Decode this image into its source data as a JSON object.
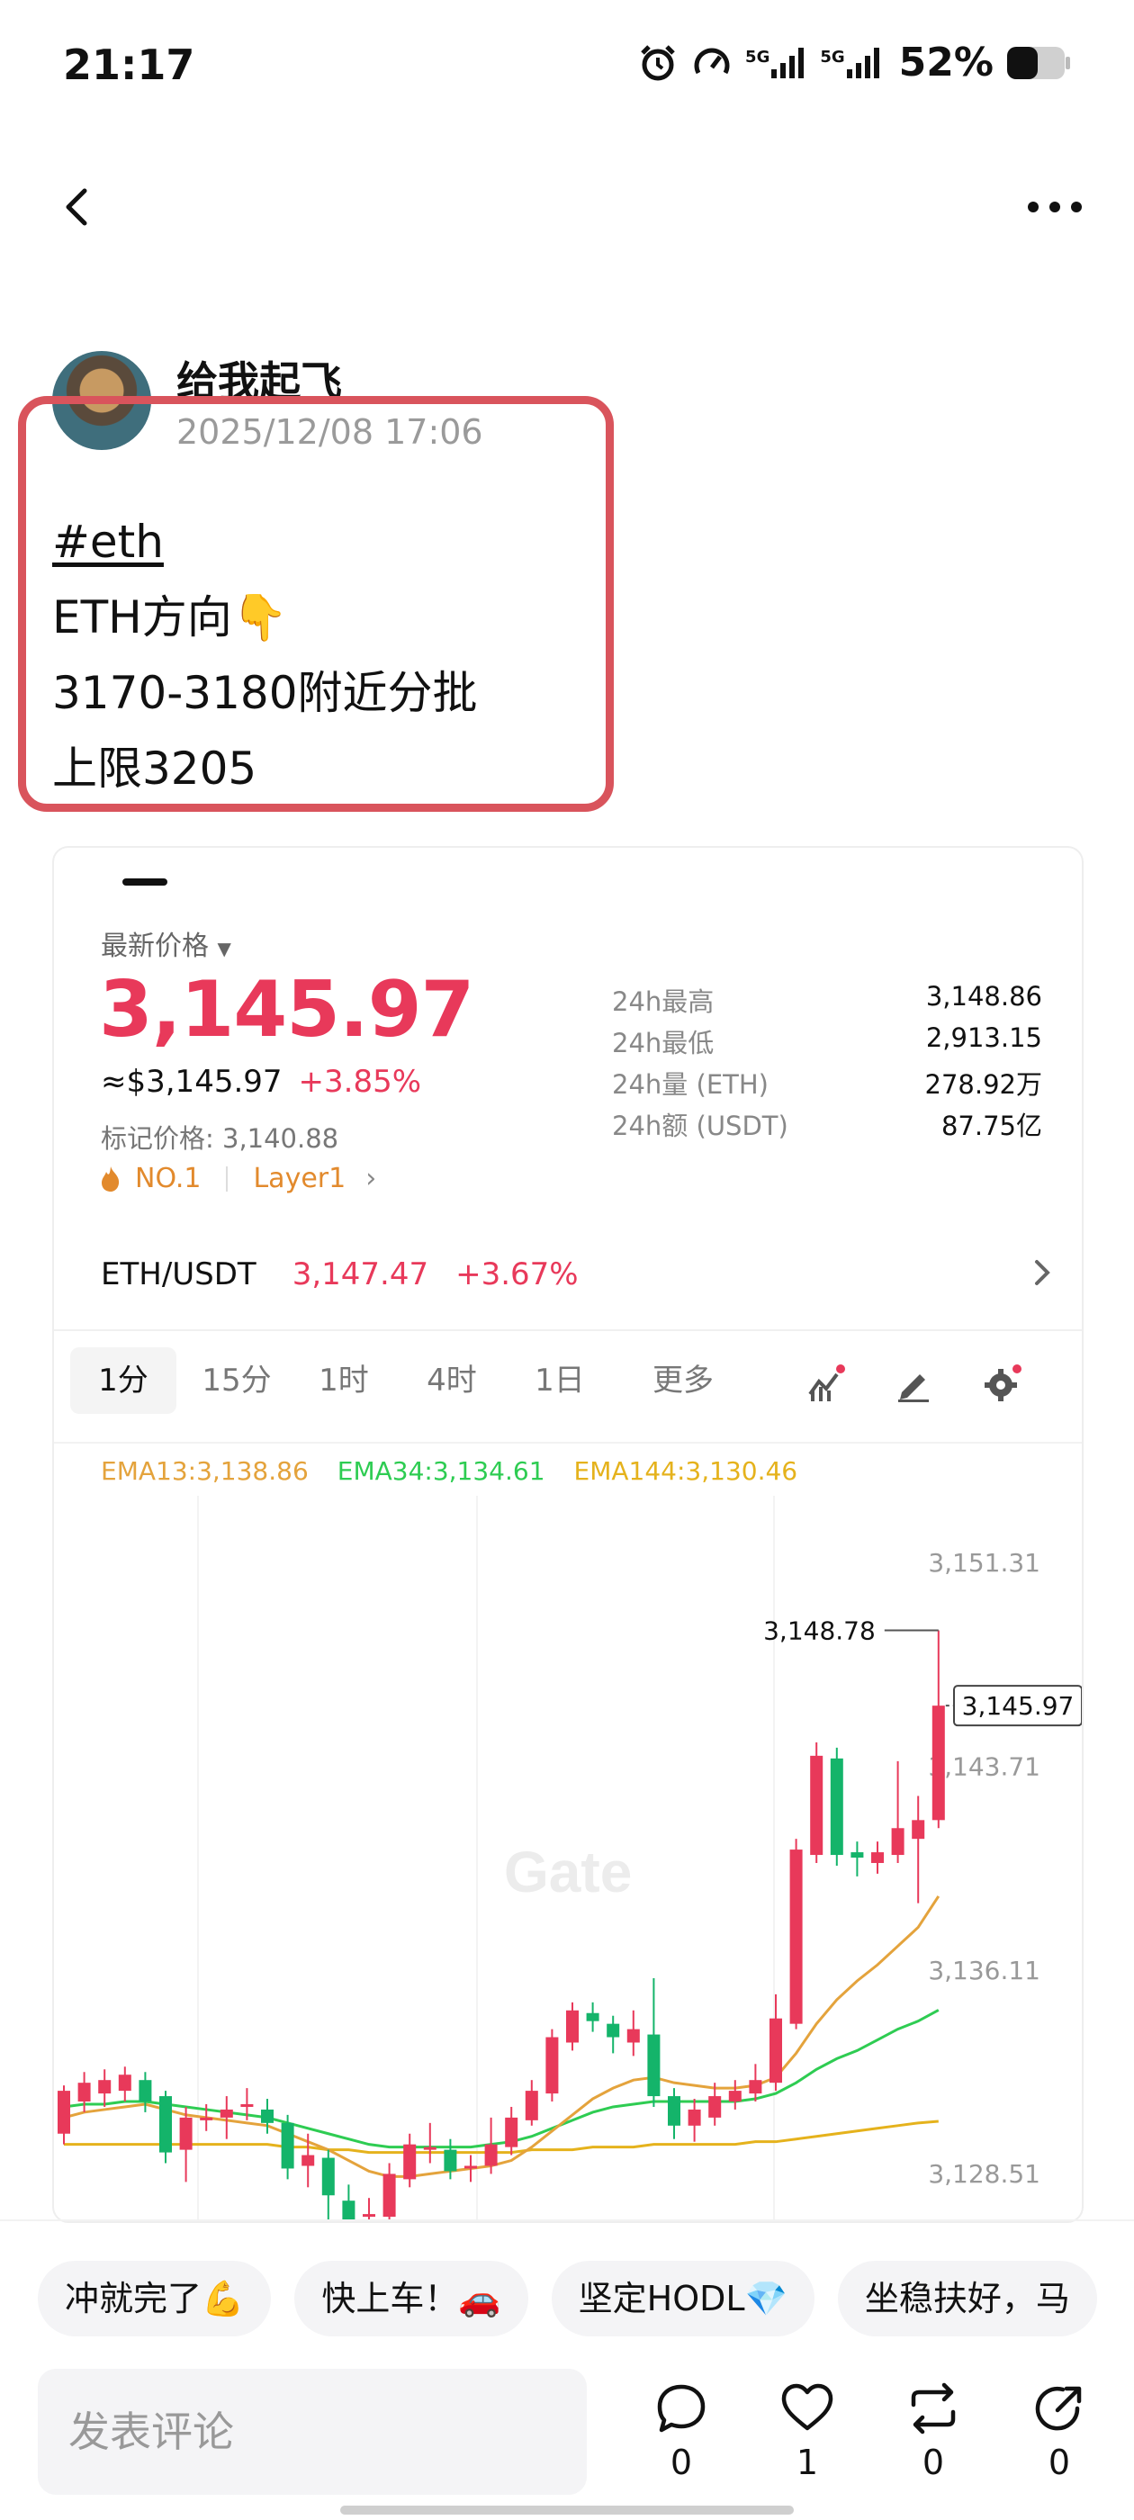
{
  "status_bar": {
    "time": "21:17",
    "network1": "5G",
    "network2": "5G",
    "battery": "52%"
  },
  "post": {
    "author": "给我起飞",
    "time": "2025/12/08 17:06",
    "lines": {
      "hashtag": "#eth",
      "l2": "ETH方向👇",
      "l3": "3170-3180附近分批",
      "l4": "上限3205"
    }
  },
  "ticker": {
    "latest_label": "最新价格",
    "price": "3,145.97",
    "usd_equiv": "≈$3,145.97",
    "change": "+3.85%",
    "mark_price": "标记价格: 3,140.88",
    "rank": "NO.1",
    "category": "Layer1",
    "stats": [
      {
        "label": "24h最高",
        "value": "3,148.86"
      },
      {
        "label": "24h最低",
        "value": "2,913.15"
      },
      {
        "label": "24h量 (ETH)",
        "value": "278.92万"
      },
      {
        "label": "24h额 (USDT)",
        "value": "87.75亿"
      }
    ],
    "pair": {
      "name": "ETH/USDT",
      "price": "3,147.47",
      "change": "+3.67%"
    },
    "intervals": [
      "1分",
      "15分",
      "1时",
      "4时",
      "1日",
      "更多"
    ],
    "active_interval": "1分",
    "ema": {
      "ema13": "EMA13:3,138.86",
      "ema34": "EMA34:3,134.61",
      "ema144": "EMA144:3,130.46"
    }
  },
  "chart_data": {
    "type": "candlestick",
    "title": "",
    "watermark": "Gate",
    "y_ticks": [
      "3,151.31",
      "3,143.71",
      "3,136.11",
      "3,128.51"
    ],
    "ylim": [
      3126.6,
      3153.8
    ],
    "high_label": "3,148.78",
    "high_value": 3148.78,
    "last_label": "3,145.97",
    "last_value": 3145.97,
    "colors": {
      "up": "#e8395a",
      "down": "#14b46a",
      "ema13": "#e4a33c",
      "ema34": "#2ecc52",
      "ema144": "#e5b21c"
    },
    "candles": [
      {
        "o": 3130.0,
        "c": 3131.6,
        "h": 3131.8,
        "l": 3129.6
      },
      {
        "o": 3131.2,
        "c": 3131.9,
        "h": 3132.3,
        "l": 3130.8
      },
      {
        "o": 3131.5,
        "c": 3132.0,
        "h": 3132.4,
        "l": 3131.0
      },
      {
        "o": 3131.6,
        "c": 3132.2,
        "h": 3132.5,
        "l": 3131.2
      },
      {
        "o": 3132.0,
        "c": 3131.2,
        "h": 3132.3,
        "l": 3130.8
      },
      {
        "o": 3131.4,
        "c": 3129.3,
        "h": 3131.6,
        "l": 3128.9
      },
      {
        "o": 3129.4,
        "c": 3130.6,
        "h": 3131.0,
        "l": 3128.2
      },
      {
        "o": 3130.5,
        "c": 3130.6,
        "h": 3131.1,
        "l": 3130.1
      },
      {
        "o": 3130.6,
        "c": 3130.9,
        "h": 3131.4,
        "l": 3129.8
      },
      {
        "o": 3131.0,
        "c": 3131.1,
        "h": 3131.7,
        "l": 3130.5
      },
      {
        "o": 3130.9,
        "c": 3130.4,
        "h": 3131.3,
        "l": 3130.0
      },
      {
        "o": 3130.4,
        "c": 3128.7,
        "h": 3130.7,
        "l": 3128.3
      },
      {
        "o": 3128.8,
        "c": 3129.2,
        "h": 3130.0,
        "l": 3128.0
      },
      {
        "o": 3129.1,
        "c": 3127.7,
        "h": 3129.4,
        "l": 3126.6
      },
      {
        "o": 3127.5,
        "c": 3126.8,
        "h": 3128.1,
        "l": 3126.4
      },
      {
        "o": 3126.9,
        "c": 3127.0,
        "h": 3127.6,
        "l": 3126.3
      },
      {
        "o": 3126.9,
        "c": 3128.5,
        "h": 3128.9,
        "l": 3126.6
      },
      {
        "o": 3128.3,
        "c": 3129.6,
        "h": 3130.0,
        "l": 3128.0
      },
      {
        "o": 3129.5,
        "c": 3129.5,
        "h": 3130.4,
        "l": 3128.9
      },
      {
        "o": 3129.4,
        "c": 3128.6,
        "h": 3129.8,
        "l": 3128.3
      },
      {
        "o": 3128.7,
        "c": 3128.8,
        "h": 3129.2,
        "l": 3128.2
      },
      {
        "o": 3128.8,
        "c": 3129.6,
        "h": 3130.6,
        "l": 3128.5
      },
      {
        "o": 3129.5,
        "c": 3130.6,
        "h": 3131.0,
        "l": 3129.2
      },
      {
        "o": 3130.5,
        "c": 3131.6,
        "h": 3132.0,
        "l": 3130.3
      },
      {
        "o": 3131.5,
        "c": 3133.6,
        "h": 3133.9,
        "l": 3131.2
      },
      {
        "o": 3133.4,
        "c": 3134.6,
        "h": 3134.9,
        "l": 3133.1
      },
      {
        "o": 3134.5,
        "c": 3134.2,
        "h": 3134.9,
        "l": 3133.8
      },
      {
        "o": 3134.1,
        "c": 3133.6,
        "h": 3134.4,
        "l": 3133.0
      },
      {
        "o": 3133.4,
        "c": 3133.9,
        "h": 3134.6,
        "l": 3132.9
      },
      {
        "o": 3133.7,
        "c": 3131.4,
        "h": 3135.8,
        "l": 3131.0
      },
      {
        "o": 3131.4,
        "c": 3130.3,
        "h": 3131.7,
        "l": 3129.8
      },
      {
        "o": 3130.3,
        "c": 3130.9,
        "h": 3131.3,
        "l": 3129.7
      },
      {
        "o": 3130.6,
        "c": 3131.4,
        "h": 3131.9,
        "l": 3130.3
      },
      {
        "o": 3131.2,
        "c": 3131.6,
        "h": 3132.0,
        "l": 3130.9
      },
      {
        "o": 3131.5,
        "c": 3132.0,
        "h": 3132.6,
        "l": 3131.2
      },
      {
        "o": 3131.9,
        "c": 3134.3,
        "h": 3135.2,
        "l": 3131.6
      },
      {
        "o": 3134.1,
        "c": 3140.6,
        "h": 3141.0,
        "l": 3133.9
      },
      {
        "o": 3140.4,
        "c": 3144.1,
        "h": 3144.6,
        "l": 3140.1
      },
      {
        "o": 3144.0,
        "c": 3140.4,
        "h": 3144.4,
        "l": 3140.0
      },
      {
        "o": 3140.5,
        "c": 3140.3,
        "h": 3140.9,
        "l": 3139.6
      },
      {
        "o": 3140.1,
        "c": 3140.5,
        "h": 3140.9,
        "l": 3139.7
      },
      {
        "o": 3140.4,
        "c": 3141.4,
        "h": 3143.9,
        "l": 3140.1
      },
      {
        "o": 3141.0,
        "c": 3141.7,
        "h": 3142.6,
        "l": 3138.6
      },
      {
        "o": 3141.7,
        "c": 3145.97,
        "h": 3148.78,
        "l": 3141.4
      }
    ],
    "ema13_series": [
      3130.6,
      3130.8,
      3130.9,
      3131.0,
      3131.1,
      3130.9,
      3130.7,
      3130.6,
      3130.5,
      3130.4,
      3130.3,
      3130.0,
      3129.7,
      3129.4,
      3129.0,
      3128.6,
      3128.4,
      3128.4,
      3128.5,
      3128.6,
      3128.7,
      3128.8,
      3129.0,
      3129.5,
      3130.1,
      3130.7,
      3131.3,
      3131.7,
      3132.0,
      3132.1,
      3131.9,
      3131.8,
      3131.7,
      3131.7,
      3131.8,
      3132.1,
      3133.0,
      3134.1,
      3135.0,
      3135.7,
      3136.3,
      3137.0,
      3137.7,
      3138.86
    ],
    "ema34_series": [
      3131.0,
      3131.1,
      3131.1,
      3131.2,
      3131.2,
      3131.1,
      3131.0,
      3130.9,
      3130.8,
      3130.7,
      3130.6,
      3130.4,
      3130.2,
      3130.0,
      3129.8,
      3129.6,
      3129.5,
      3129.5,
      3129.5,
      3129.5,
      3129.5,
      3129.6,
      3129.7,
      3129.9,
      3130.2,
      3130.5,
      3130.8,
      3131.0,
      3131.1,
      3131.2,
      3131.2,
      3131.2,
      3131.2,
      3131.2,
      3131.3,
      3131.5,
      3131.9,
      3132.4,
      3132.8,
      3133.1,
      3133.5,
      3133.9,
      3134.2,
      3134.61
    ],
    "ema144_series": [
      3129.6,
      3129.6,
      3129.6,
      3129.6,
      3129.6,
      3129.6,
      3129.6,
      3129.6,
      3129.6,
      3129.6,
      3129.6,
      3129.5,
      3129.5,
      3129.4,
      3129.4,
      3129.3,
      3129.3,
      3129.3,
      3129.3,
      3129.3,
      3129.3,
      3129.3,
      3129.3,
      3129.4,
      3129.4,
      3129.4,
      3129.5,
      3129.5,
      3129.5,
      3129.6,
      3129.6,
      3129.6,
      3129.6,
      3129.6,
      3129.7,
      3129.7,
      3129.8,
      3129.9,
      3130.0,
      3130.1,
      3130.2,
      3130.3,
      3130.4,
      3130.46
    ]
  },
  "quick_comments": [
    "冲就完了💪",
    "快上车！🚗",
    "坚定HODL💎",
    "坐稳扶好，马"
  ],
  "comment_input": {
    "placeholder": "发表评论"
  },
  "actions": {
    "comment": "0",
    "like": "1",
    "repost": "0",
    "share": "0"
  }
}
